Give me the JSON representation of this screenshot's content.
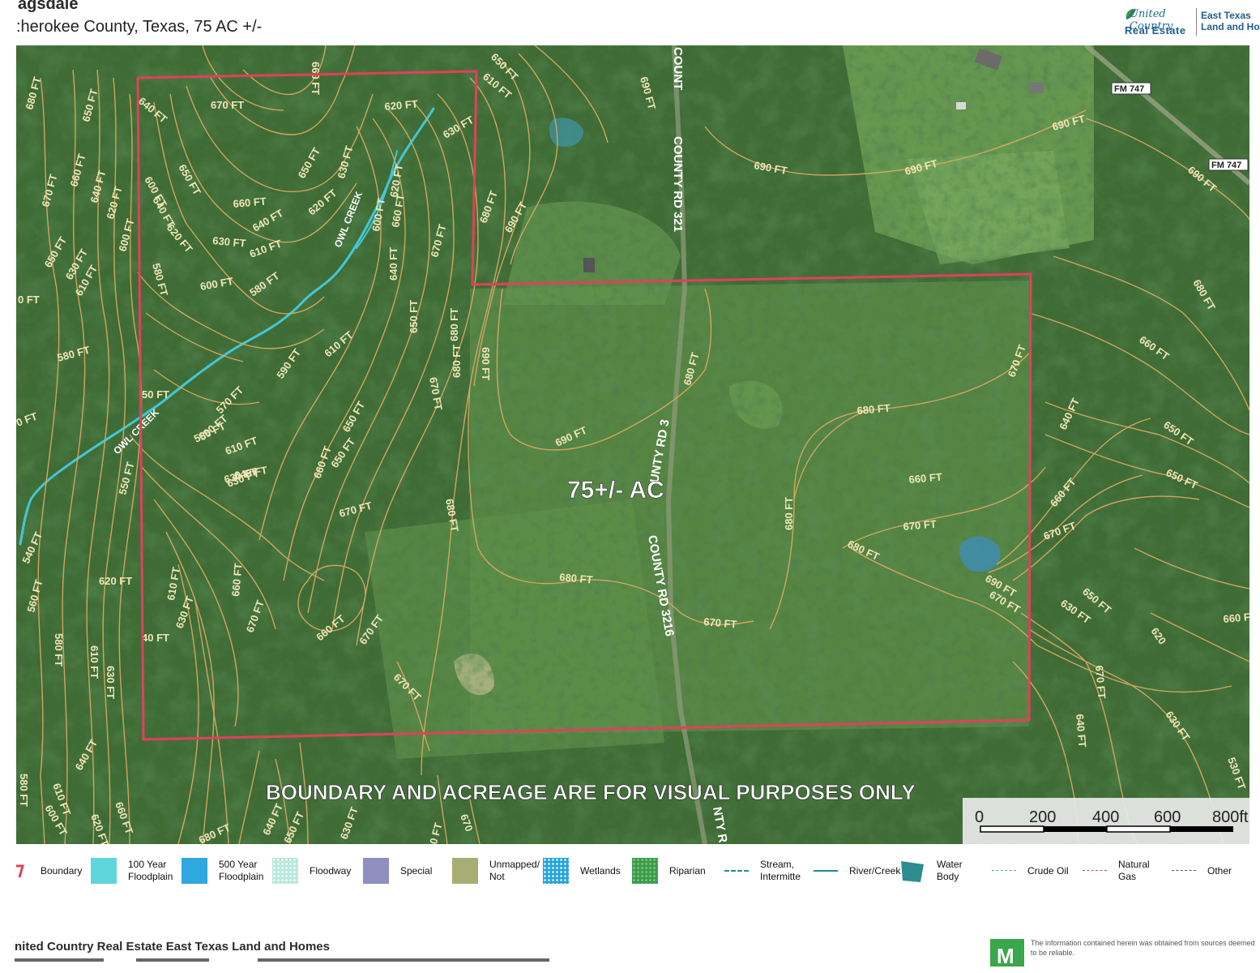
{
  "header": {
    "title_fragment": "agsdale",
    "subtitle": ":herokee County, Texas, 75 AC +/-",
    "logo_top": "United Country",
    "logo_bottom": "Real Estate",
    "brand_line1": "East Texas",
    "brand_line2": "Land and Ho"
  },
  "map": {
    "acreage_label": "75+/- AC",
    "disclaimer": "BOUNDARY AND ACREAGE ARE FOR VISUAL PURPOSES ONLY",
    "roads": {
      "road_a": "COUNT",
      "road_b": "COUNTY RD 321",
      "road_c": "COUNTY RD 3216",
      "road_d": "COUNTY RD 3216",
      "road_e": "UNTY RD 3",
      "road_f": "NTY R",
      "fm_a": "FM 747",
      "fm_b": "FM 747"
    },
    "creeks": {
      "creek_a": "OWL CREEK",
      "creek_b": "OWL CREEK"
    },
    "scale": {
      "ticks": [
        "0",
        "200",
        "400",
        "600",
        "800ft"
      ]
    },
    "contour_labels": [
      "680 FT",
      "650 FT",
      "670 FT",
      "660 FT",
      "640 FT",
      "620 FT",
      "600 FT",
      "650 FT",
      "630 FT",
      "610 FT",
      "0 FT",
      "580 FT",
      "0 FT",
      "640 FT",
      "670 FT",
      "660 FT",
      "650 FT",
      "630 FT",
      "620 FT",
      "610 FT",
      "660 FT",
      "640 FT",
      "620 FT",
      "630 FT",
      "600 FT",
      "610 FT",
      "580 FT",
      "600 FT",
      "580 FT",
      "640 FT",
      "620 FT",
      "600 FT",
      "630 FT",
      "650 FT",
      "650 FT",
      "690 FT",
      "690 FT",
      "690 FT",
      "690 FT",
      "690 FT",
      "680 FT",
      "690 FT",
      "680 FT",
      "670 FT",
      "680 FT",
      "650 FT",
      "660 FT",
      "640 FT",
      "620 FT",
      "610 FT",
      "590 FT",
      "570 FT",
      "580 FT",
      "550 FT",
      "610 FT",
      "630 FT",
      "650 FT",
      "660 FT",
      "670 FT",
      "670 FT",
      "680 FT",
      "690 FT",
      "690 FT",
      "680 FT",
      "680 FT",
      "670 FT",
      "660 FT",
      "650 FT",
      "640 FT",
      "630 FT",
      "620 FT",
      "590 FT",
      "610 FT",
      "630 FT",
      "660 FT",
      "670 FT",
      "680 FT",
      "670 FT",
      "680 FT",
      "680 FT",
      "670 FT",
      "660 FT",
      "670 FT",
      "680 FT",
      "690 FT",
      "670 FT",
      "660 FT",
      "650 FT",
      "660 FT",
      "650 FT",
      "670 FT",
      "640 FT",
      "650 FT",
      "630 FT",
      "620",
      "660 FT",
      "670 FT",
      "640 FT",
      "630 FT",
      "530 FT",
      "540 FT",
      "560 FT",
      "580 FT",
      "610 FT",
      "630 FT",
      "640 FT",
      "580 FT",
      "610 FT",
      "600 FT",
      "620 FT",
      "680 FT",
      "640 FT",
      "660 FT",
      "630 FT",
      "670",
      "670 FT",
      "50 FT",
      "40 FT",
      "650 FT",
      "640 FT"
    ]
  },
  "legend": {
    "boundary": "Boundary",
    "floodplain_100": "100 Year Floodplain",
    "floodplain_500": "500 Year Floodplain",
    "floodway": "Floodway",
    "special": "Special",
    "unmapped": "Unmapped/ Not",
    "wetlands": "Wetlands",
    "riparian": "Riparian",
    "stream": "Stream, Intermitte",
    "river": "River/Creek",
    "water": "Water Body",
    "crude": "Crude Oil",
    "gas": "Natural Gas",
    "other": "Other",
    "colors": {
      "boundary": "#e2405c",
      "floodplain_100": "#5fd6dc",
      "floodplain_500": "#2fa8e0",
      "floodway": "#b8e8dc",
      "special": "#8f90c0",
      "unmapped": "#a7ae74",
      "wetlands": "#25a4dd",
      "riparian": "#3a9a52",
      "stream": "#22918f",
      "river": "#1c8ba0",
      "water": "#2c8e90",
      "crude": "#5aa57a",
      "gas": "#b25060",
      "other": "#555555"
    }
  },
  "footer": {
    "company": "nited Country Real Estate East Texas Land and Homes",
    "mls_letter": "M",
    "disclaimer": "The information contained herein was obtained from sources deemed to be reliable."
  }
}
